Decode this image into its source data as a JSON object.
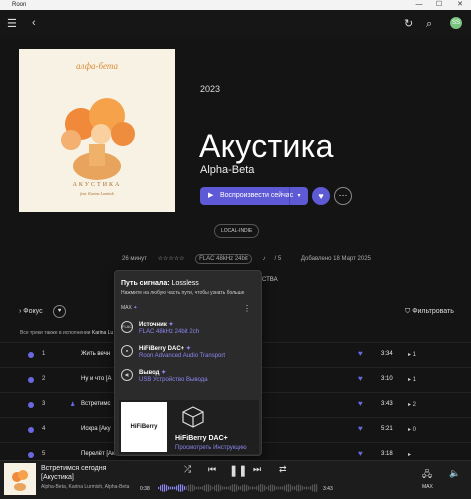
{
  "window": {
    "title": "Roon",
    "controls": [
      "—",
      "☐",
      "✕"
    ]
  },
  "topbar": {
    "avatar": "SS"
  },
  "album": {
    "year": "2023",
    "title": "Акустика",
    "artist": "Alpha-Beta",
    "genre": "LOCAL-INDIE",
    "cover": {
      "title": "алфа-бета",
      "subtitle": "АКУСТИКА",
      "credit": "feat. Karina Lurmish"
    },
    "play_label": "Воспроизвести сейчас"
  },
  "meta": {
    "duration": "26 минут",
    "rating": "☆☆☆☆☆",
    "format": "FLAC 48kHz 24bit",
    "tracks": "5",
    "added": "Добавлено 18 Март 2025",
    "trailing": "СТВА"
  },
  "focus": {
    "label": "Фокус",
    "filter_label": "Фильтровать"
  },
  "also_performed": {
    "prefix": "Все треки также в исполнении",
    "name": "Karina Lu"
  },
  "tracks": [
    {
      "num": "1",
      "name": "Жить вечн",
      "dur": "3:34",
      "act": "▸ 1"
    },
    {
      "num": "2",
      "name": "Ну и что [А",
      "dur": "3:10",
      "act": "▸ 1"
    },
    {
      "num": "3",
      "name": "Встретимс",
      "dur": "3:43",
      "act": "▸ 2"
    },
    {
      "num": "4",
      "name": "Искра [Аку",
      "dur": "5:21",
      "act": "▸ 0"
    },
    {
      "num": "5",
      "name": "Перелёт [Ак",
      "dur": "3:18",
      "act": "▸"
    }
  ],
  "signal_path": {
    "title": "Путь сигнала:",
    "quality": "Lossless",
    "hint": "Нажмите на любую часть пути, чтобы узнать больше",
    "max_label": "MAX",
    "stages": [
      {
        "icon": "FLAC",
        "label": "Источник",
        "sub": "FLAC 48kHz 24bit 2ch"
      },
      {
        "icon": "●",
        "label": "HiFiBerry DAC+",
        "sub": "Roon Advanced Audio Transport"
      },
      {
        "icon": "◀)",
        "label": "Вывод",
        "sub": "USB Устройство Вывода"
      }
    ],
    "device": {
      "logo": "HiFiBerry",
      "name": "HiFiBerry DAC+",
      "manual": "Просмотреть Инструкцию"
    }
  },
  "now_playing": {
    "title": "Встретимся сегодня",
    "album": "[Акустика]",
    "artists": "Alpha-Beta, Karina Lurmish, Alpha-Beta",
    "elapsed": "0:38",
    "total": "3:43",
    "progress": 0.17,
    "zone_label": "MAX"
  },
  "colors": {
    "accent": "#5e5ad6",
    "background": "#141414"
  }
}
